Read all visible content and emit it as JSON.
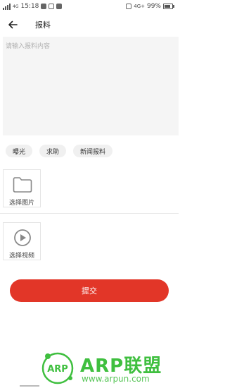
{
  "status_bar": {
    "signal_text": "4G",
    "time": "15:18",
    "network": "4G+",
    "battery": "99%"
  },
  "header": {
    "title": "报料"
  },
  "report": {
    "placeholder": "请输入报料内容",
    "value": ""
  },
  "tags": [
    {
      "label": "曝光"
    },
    {
      "label": "求助"
    },
    {
      "label": "新闻报料"
    }
  ],
  "media": {
    "image_label": "选择图片",
    "video_label": "选择视频"
  },
  "submit_label": "提交",
  "watermark": {
    "brand": "ARP联盟",
    "logo_text": "ARP",
    "url": "www.arpun.com"
  },
  "colors": {
    "accent": "#e23628",
    "watermark": "#3fbf3f"
  }
}
